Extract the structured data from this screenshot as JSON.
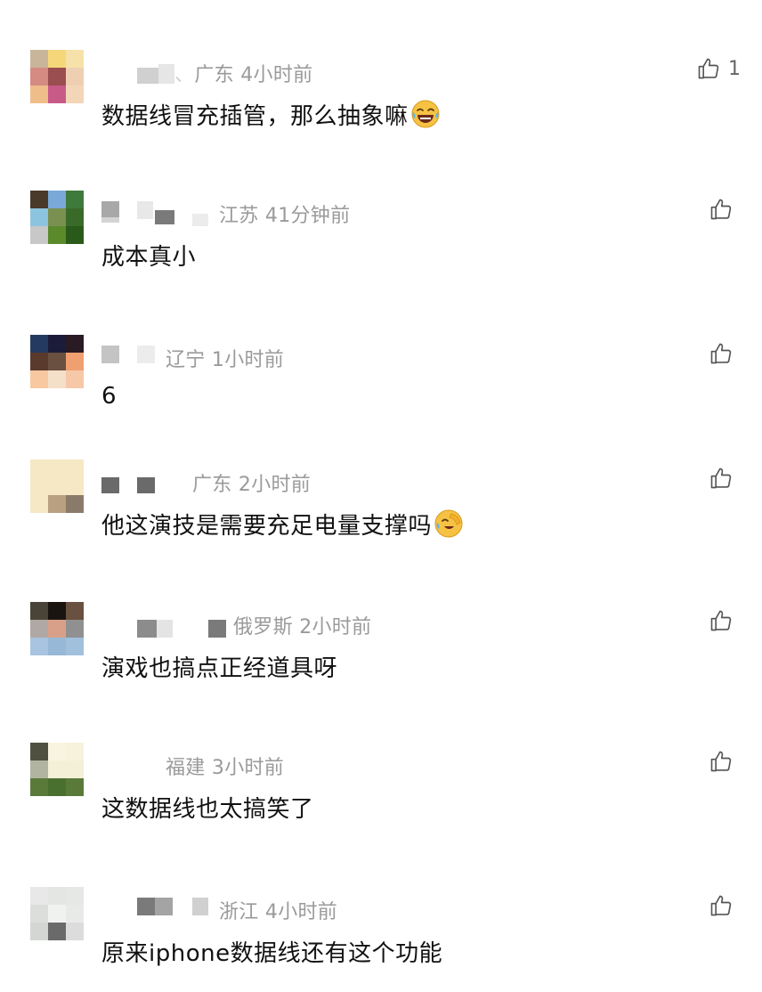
{
  "comments": [
    {
      "location": "广东",
      "time": "4小时前",
      "text": "数据线冒充插管，那么抽象嘛",
      "emoji": "laughing-crying-emoji",
      "likes": "1",
      "avatar_colors": [
        "#c9b59a",
        "#f5d77a",
        "#f6e2a8",
        "#d58a82",
        "#9b4e4f",
        "#efcfb1",
        "#efbd8a",
        "#c85a8a",
        "#f3d6b8"
      ]
    },
    {
      "location": "江苏",
      "time": "41分钟前",
      "text": "成本真小",
      "likes": "",
      "avatar_colors": [
        "#4a3a2a",
        "#7aa8d8",
        "#3e7a3c",
        "#8cc4e0",
        "#7a9050",
        "#3a6a2a",
        "#c8c8c8",
        "#5a8a2a",
        "#2a5a1a"
      ]
    },
    {
      "location": "辽宁",
      "time": "1小时前",
      "text": "6",
      "likes": "",
      "avatar_colors": [
        "#243a60",
        "#1c1c3a",
        "#2a1a24",
        "#5a3a2c",
        "#6a5040",
        "#f0a070",
        "#f8c8a0",
        "#f4e0c8",
        "#f6c8a8"
      ]
    },
    {
      "location": "广东",
      "time": "2小时前",
      "text": "他这演技是需要充足电量支撑吗",
      "emoji": "facepalm-laugh-emoji",
      "likes": "",
      "avatar_colors": [
        "#f6e8c4",
        "#f6e8c4",
        "#f6e8c4",
        "#f6e8c4",
        "#f6e8c4",
        "#f6e8c4",
        "#f6e8c4",
        "#b8a080",
        "#8a7a6a"
      ]
    },
    {
      "location": "俄罗斯",
      "time": "2小时前",
      "text": "演戏也搞点正经道具呀",
      "likes": "",
      "avatar_colors": [
        "#4a4438",
        "#1a1410",
        "#6a5040",
        "#b0a8a4",
        "#d8a088",
        "#909090",
        "#a8c4e0",
        "#98b8d8",
        "#a0c0dc"
      ]
    },
    {
      "location": "福建",
      "time": "3小时前",
      "text": "这数据线也太搞笑了",
      "likes": "",
      "avatar_colors": [
        "#505040",
        "#f8f4e0",
        "#f6f2dc",
        "#b0b4a0",
        "#f4f0d8",
        "#f4f0d8",
        "#5a7a3a",
        "#4a7030",
        "#5a7a3a"
      ]
    },
    {
      "location": "浙江",
      "time": "4小时前",
      "text": "原来iphone数据线还有这个功能",
      "likes": "",
      "avatar_colors": [
        "#e8e8e8",
        "#e4e6e4",
        "#e6e8e6",
        "#dcdedc",
        "#f0f2f0",
        "#e8eae8",
        "#d4d6d4",
        "#6a6a6a",
        "#dcdcdc"
      ]
    }
  ],
  "colors": {
    "meta_text": "#9a9a9a",
    "body_text": "#111111",
    "icon_stroke": "#555555"
  },
  "icons": {
    "like": "thumbs-up-outline-icon"
  }
}
